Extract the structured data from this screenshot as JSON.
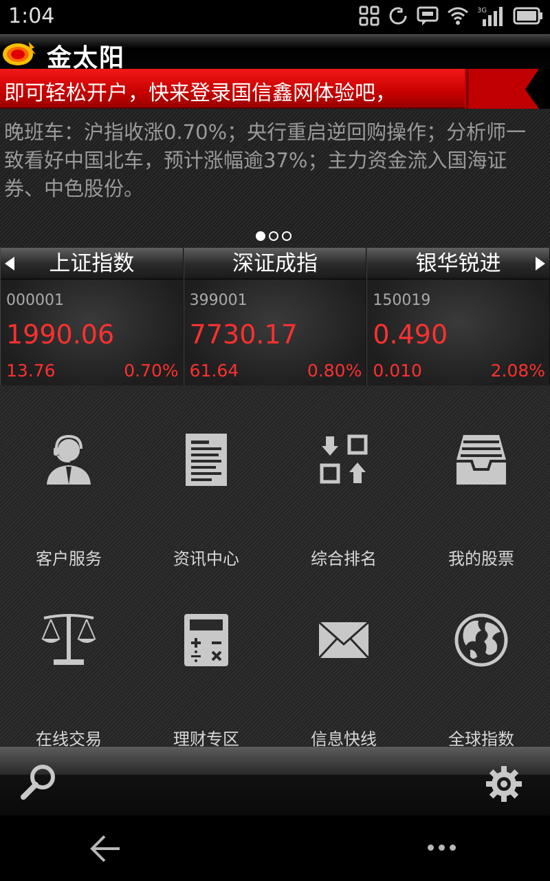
{
  "status_bar": {
    "time": "1:04",
    "network": "3G"
  },
  "app": {
    "name": "金太阳"
  },
  "banner": {
    "text": "即可轻松开户，快来登录国信鑫网体验吧，"
  },
  "news": {
    "text": "晚班车：沪指收涨0.70%；央行重启逆回购操作；分析师一致看好中国北车，预计涨幅逾37%；主力资金流入国海证券、中色股份。",
    "page_count": 3,
    "active_page": 1
  },
  "indexes": [
    {
      "name": "上证指数",
      "code": "000001",
      "price": "1990.06",
      "change": "13.76",
      "percent": "0.70%"
    },
    {
      "name": "深证成指",
      "code": "399001",
      "price": "7730.17",
      "change": "61.64",
      "percent": "0.80%"
    },
    {
      "name": "银华锐进",
      "code": "150019",
      "price": "0.490",
      "change": "0.010",
      "percent": "2.08%"
    }
  ],
  "menu": [
    {
      "label": "客户服务",
      "icon": "customer-service-icon"
    },
    {
      "label": "资讯中心",
      "icon": "news-center-icon"
    },
    {
      "label": "综合排名",
      "icon": "ranking-icon"
    },
    {
      "label": "我的股票",
      "icon": "my-stocks-icon"
    },
    {
      "label": "在线交易",
      "icon": "scales-icon"
    },
    {
      "label": "理财专区",
      "icon": "calculator-icon"
    },
    {
      "label": "信息快线",
      "icon": "envelope-icon"
    },
    {
      "label": "全球指数",
      "icon": "globe-icon"
    }
  ],
  "colors": {
    "up": "#ff3030",
    "banner": "#e00000",
    "icon": "#c8c8c8"
  }
}
